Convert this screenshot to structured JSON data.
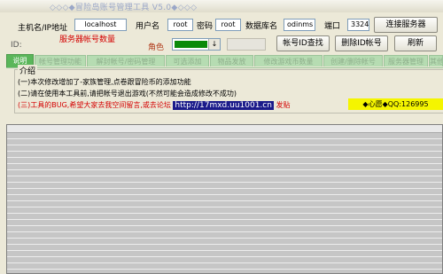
{
  "window": {
    "title": "◇◇◇◆冒险岛账号管理工具 V5.0◆◇◇◇"
  },
  "connection": {
    "host_label": "主机名/IP地址",
    "host_value": "localhost",
    "user_label": "用户名",
    "user_value": "root",
    "password_label": "密码",
    "password_value": "root",
    "db_label": "数据库名",
    "db_value": "odinms",
    "port_label": "端口",
    "port_value": "3324",
    "connect_button": "连接服务器"
  },
  "account": {
    "id_label": "ID:",
    "server_count_label": "服务器帐号数量",
    "role_label": "角色",
    "dropdown_arrow": "↓",
    "id_search_button": "帐号ID查找",
    "delete_id_button": "删除ID帐号",
    "refresh_button": "刷新"
  },
  "tabs": [
    {
      "label": "说明",
      "active": true
    },
    {
      "label": "帐号管理功能",
      "active": false
    },
    {
      "label": "解封帐号/密码管理",
      "active": false
    },
    {
      "label": "可选添加",
      "active": false
    },
    {
      "label": "物品发放",
      "active": false
    },
    {
      "label": "修改游戏币数量",
      "active": false
    },
    {
      "label": "创建/删除帐号",
      "active": false
    },
    {
      "label": "服务器管理",
      "active": false
    },
    {
      "label": "其他功能",
      "active": false
    }
  ],
  "intro": {
    "legend": "介绍",
    "line1": "(一)本次修改增加了-家族管理,点卷跟冒险币的添加功能",
    "line2": "(二)请在使用本工具前,请把帐号退出游戏(不然可能会造成修改不成功)",
    "line3_prefix": "(三)工具的BUG,希望大家去我空间留言,或去论坛",
    "url": "http://17mxd.uu1001.cn",
    "line3_suffix": "发贴",
    "qq_badge": "◆心愿◆QQ:126995"
  },
  "colors": {
    "tab_active": "#5ab65a",
    "tab_inactive": "#b6dcb2",
    "accent_red": "#d40000",
    "qq_yellow": "#f5f500",
    "url_bg": "#1a1a8a"
  }
}
